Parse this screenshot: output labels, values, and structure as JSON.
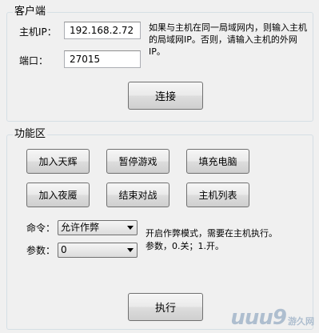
{
  "client_section": {
    "title": "客户端",
    "host_ip_label": "主机IP：",
    "host_ip_value": "192.168.2.72",
    "port_label": "端口：",
    "port_value": "27015",
    "note": "如果与主机在同一局域网内，则输入主机的局域网IP。否则，请输入主机的外网IP。",
    "connect_button": "连接"
  },
  "function_section": {
    "title": "功能区",
    "buttons_row1": [
      "加入天辉",
      "暂停游戏",
      "填充电脑"
    ],
    "buttons_row2": [
      "加入夜魇",
      "结束对战",
      "主机列表"
    ],
    "command_label": "命令：",
    "command_value": "允许作弊",
    "param_label": "参数：",
    "param_value": "0",
    "help_line1": "开启作弊模式，需要在主机执行。",
    "help_line2": "参数，0.关；1.开。",
    "execute_button": "执行"
  },
  "watermark": {
    "logo": "uuu9",
    "site": "游久网"
  },
  "colors": {
    "background": "#f0f0f0",
    "group_border": "#d5dfe5",
    "button_border": "#707070"
  }
}
